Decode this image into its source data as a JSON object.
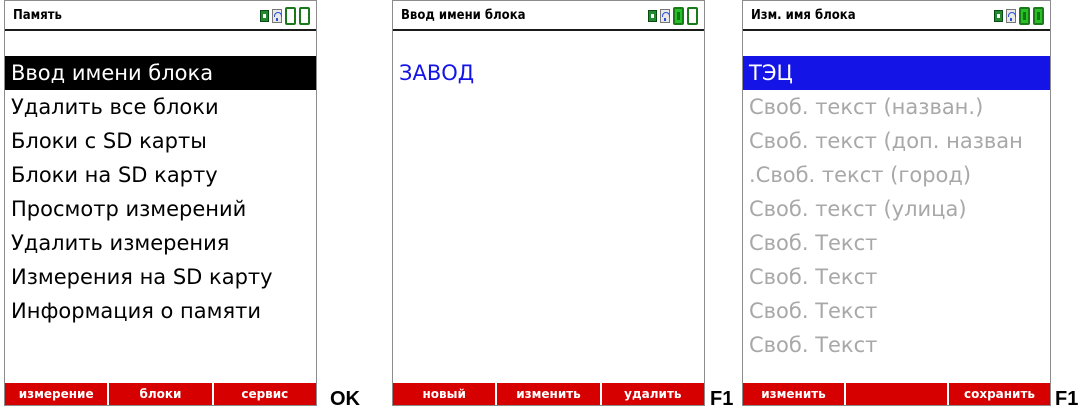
{
  "screen1": {
    "title": "Память",
    "items": [
      "Ввод имени блока",
      "Удалить все блоки",
      "Блоки  с SD карты",
      "Блоки  на SD карту",
      "Просмотр измерений",
      "Удалить измерения",
      "Измерения на SD карту",
      "Информация о памяти"
    ],
    "softkeys": [
      "измерение",
      "блоки",
      "сервис"
    ]
  },
  "key1": "OK",
  "screen2": {
    "title": "Ввод имени блока",
    "value": "ЗАВОД",
    "softkeys": [
      "новый",
      "изменить",
      "удалить"
    ]
  },
  "key2": "F1",
  "screen3": {
    "title": "Изм. имя блока",
    "items": [
      "ТЭЦ",
      "Своб. текст (назван.)",
      "Своб. текст (доп. назван",
      ".Своб. текст (город)",
      "Своб. текст (улица)",
      "Своб. Текст",
      "Своб. Текст",
      "Своб. Текст",
      "Своб. Текст"
    ],
    "softkeys": [
      "изменить",
      "",
      "сохранить"
    ]
  },
  "key3": "F1",
  "colors": {
    "softkey_bar": "#d60000",
    "highlight_blue": "#1414e6",
    "value_blue": "#1414e6",
    "dim_text": "#a8a8a8"
  }
}
